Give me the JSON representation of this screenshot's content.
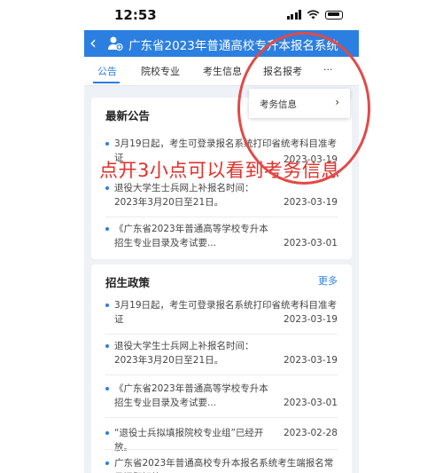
{
  "status_bar": {
    "time": "12:53"
  },
  "header": {
    "back_icon": "chevron-left-icon",
    "title": "广东省2023年普通高校专升本报名系统"
  },
  "tabs": [
    {
      "label": "公告"
    },
    {
      "label": "院校专业"
    },
    {
      "label": "考生信息"
    },
    {
      "label": "报名报考"
    },
    {
      "label": "···"
    }
  ],
  "dropdown_menu": {
    "item_label": "考务信息",
    "arrow": "›"
  },
  "annotation": {
    "text": "点开3小点可以看到考务信息"
  },
  "news_card": {
    "title": "最新公告",
    "items": [
      {
        "text": "3月19日起，考生可登录报名系统打印省统考科目准考证",
        "date": "2023-03-19"
      },
      {
        "text": "退役大学生士兵网上补报名时间：2023年3月20日至21日。",
        "date": "2023-03-19"
      },
      {
        "text": "《广东省2023年普通高等学校专升本 招生专业目录及考试要...",
        "date": "2023-03-01"
      }
    ]
  },
  "policy_card": {
    "title": "招生政策",
    "more": "更多",
    "items": [
      {
        "text": "3月19日起，考生可登录报名系统打印省统考科目准考证",
        "date": "2023-03-19"
      },
      {
        "text": "退役大学生士兵网上补报名时间：2023年3月20日至21日。",
        "date": "2023-03-19"
      },
      {
        "text": "《广东省2023年普通高等学校专升本 招生专业目录及考试要...",
        "date": "2023-03-01"
      },
      {
        "text": "“退役士兵拟填报院校专业组”已经开放。",
        "date": "2023-02-28"
      },
      {
        "text": "广东省2023年普通高校专升本报名系统考生端报名常见问题解答",
        "date": ""
      }
    ]
  },
  "colors": {
    "accent": "#2b7fe0",
    "annotation": "#e0302a"
  }
}
